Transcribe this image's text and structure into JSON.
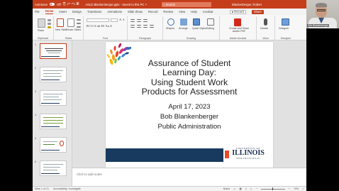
{
  "titlebar": {
    "autosave": "AutoSave",
    "autosave_state": "Off",
    "quick_access": "⎘ ↶ ↷ ▣",
    "document": "ASLD Blankenberger.pptx - Saved to this PC ˅",
    "search": "Search",
    "user": "Blankenberger, Robert"
  },
  "tabs": {
    "items": [
      "File",
      "Home",
      "Insert",
      "Design",
      "Transitions",
      "Animations",
      "Slide Show",
      "Record",
      "Review",
      "View",
      "Help",
      "Acrobat"
    ],
    "active_index": 1,
    "record_button": "● Record",
    "share_button": "Share"
  },
  "ribbon": {
    "groups": {
      "clipboard": "Clipboard",
      "slides": "Slides",
      "font": "Font",
      "paragraph": "Paragraph",
      "drawing": "Drawing",
      "adobe_acrobat": "Adobe Acrobat",
      "voice": "Voice",
      "designer": "Designer"
    },
    "buttons": {
      "paste": "Paste",
      "new_slide": "New Slide",
      "reuse_slides": "Reuse Slides",
      "shapes": "Shapes",
      "arrange": "Arrange",
      "quick_styles": "Quick Styles",
      "editing": "Editing",
      "create_share": "Create and Share Adobe PDF",
      "dictate": "Dictate",
      "designer": "Designer"
    },
    "font_format": "B  I  U  S  ab  AV  Aa  A"
  },
  "thumbnails": {
    "numbers": [
      "1",
      "2",
      "3",
      "4",
      "5",
      "6"
    ],
    "selected_index": 0
  },
  "slide": {
    "title_lines": [
      "Assurance of Student",
      "Learning Day:",
      "Using Student Work",
      "Products for Assessment"
    ],
    "date": "April 17, 2023",
    "presenter": "Bob Blankenberger",
    "department": "Public Administration",
    "logo_top": "UNIVERSITY OF",
    "logo_main": "ILLINOIS",
    "logo_bottom": "SPRINGFIELD"
  },
  "notes_placeholder": "Click to add notes",
  "status": {
    "slide_count": "Slide 1 of 21",
    "accessibility": "Accessibility: Investigate",
    "notes": "Notes",
    "zoom": "70%"
  },
  "webcam": {
    "name_tag": "Bob Blankenberger"
  },
  "colors": {
    "accent": "#c43e1c",
    "band": "#173a5e",
    "logo_orange": "#e84a27"
  }
}
